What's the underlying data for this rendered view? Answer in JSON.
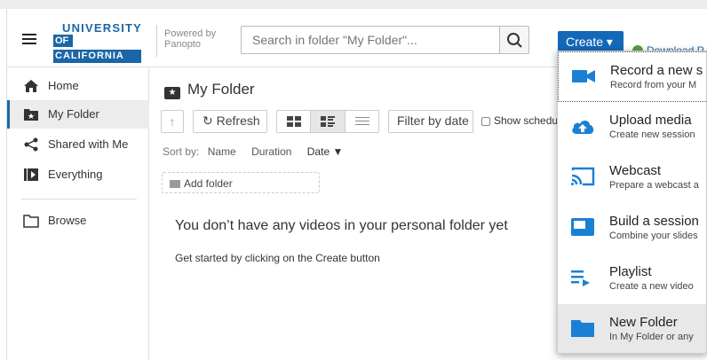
{
  "header": {
    "logo_line1": "UNIVERSITY",
    "logo_line2": "OF",
    "logo_line3": "CALIFORNIA",
    "powered_by": "Powered by Panopto",
    "search_placeholder": "Search in folder \"My Folder\"...",
    "create_label": "Create ▾",
    "download_label": "Download P"
  },
  "sidebar": {
    "items": [
      {
        "label": "Home",
        "icon": "home-icon"
      },
      {
        "label": "My Folder",
        "icon": "star-folder-icon",
        "active": true
      },
      {
        "label": "Shared with Me",
        "icon": "share-icon"
      },
      {
        "label": "Everything",
        "icon": "play-icon"
      },
      {
        "label": "Browse",
        "icon": "folder-icon"
      }
    ]
  },
  "main": {
    "title": "My Folder",
    "refresh_label": "Refresh",
    "filter_label": "Filter by date",
    "show_scheduled": "Show schedu",
    "sort_label": "Sort by:",
    "sort_name": "Name",
    "sort_duration": "Duration",
    "sort_date": "Date ▼",
    "add_folder": "Add folder",
    "empty_message": "You don’t have any videos in your personal folder yet",
    "empty_sub": "Get started by clicking on the Create button"
  },
  "create_menu": {
    "items": [
      {
        "title": "Record a new s",
        "desc": "Record from your M",
        "icon": "video-camera-icon"
      },
      {
        "title": "Upload media",
        "desc": "Create new session",
        "icon": "cloud-upload-icon"
      },
      {
        "title": "Webcast",
        "desc": "Prepare a webcast a",
        "icon": "cast-icon"
      },
      {
        "title": "Build a session",
        "desc": "Combine your slides",
        "icon": "slides-icon"
      },
      {
        "title": "Playlist",
        "desc": "Create a new video",
        "icon": "playlist-icon"
      },
      {
        "title": "New Folder",
        "desc": "In My Folder or any",
        "icon": "folder-icon"
      }
    ]
  },
  "colors": {
    "brand_blue": "#1b66a6",
    "create_blue": "#1468b8",
    "menu_icon_blue": "#1a80d4"
  }
}
